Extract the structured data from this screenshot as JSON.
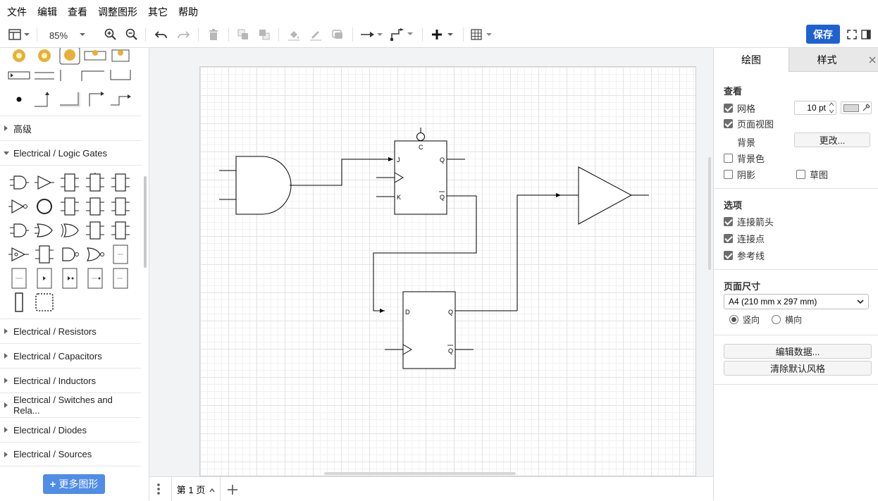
{
  "menubar": {
    "items": [
      "文件",
      "编辑",
      "查看",
      "调整图形",
      "其它",
      "帮助"
    ]
  },
  "toolbar": {
    "zoom": "85%",
    "save_label": "保存"
  },
  "sidebar": {
    "sections": [
      {
        "label": "高级",
        "expanded": false
      },
      {
        "label": "Electrical / Logic Gates",
        "expanded": true
      },
      {
        "label": "Electrical / Resistors",
        "expanded": false
      },
      {
        "label": "Electrical / Capacitors",
        "expanded": false
      },
      {
        "label": "Electrical / Inductors",
        "expanded": false
      },
      {
        "label": "Electrical / Switches and Rela...",
        "expanded": false
      },
      {
        "label": "Electrical / Diodes",
        "expanded": false
      },
      {
        "label": "Electrical / Sources",
        "expanded": false
      }
    ],
    "more_shapes_label": "更多图形"
  },
  "diagram": {
    "jk_flipflop": {
      "j": "J",
      "k": "K",
      "c": "C",
      "q": "Q",
      "q_bar": "Q"
    },
    "d_flipflop": {
      "d": "D",
      "q": "Q",
      "q_bar": "Q"
    }
  },
  "pagebar": {
    "page_tab": "第 1 页"
  },
  "rightpanel": {
    "tabs": [
      "绘图",
      "样式"
    ],
    "view_title": "查看",
    "grid_label": "网格",
    "grid_size": "10 pt",
    "page_view_label": "页面视图",
    "background_label": "背景",
    "change_button": "更改...",
    "bg_color_label": "背景色",
    "shadow_label": "阴影",
    "sketch_label": "草图",
    "options_title": "选项",
    "connection_arrows_label": "连接箭头",
    "connection_points_label": "连接点",
    "guides_label": "参考线",
    "page_size_title": "页面尺寸",
    "page_size_value": "A4 (210 mm x 297 mm)",
    "portrait_label": "竖向",
    "landscape_label": "横向",
    "edit_data_button": "编辑数据...",
    "clear_style_button": "清除默认风格"
  },
  "colors": {
    "accent": "#1e62d0",
    "more_shapes_bg": "#4f8de6"
  }
}
